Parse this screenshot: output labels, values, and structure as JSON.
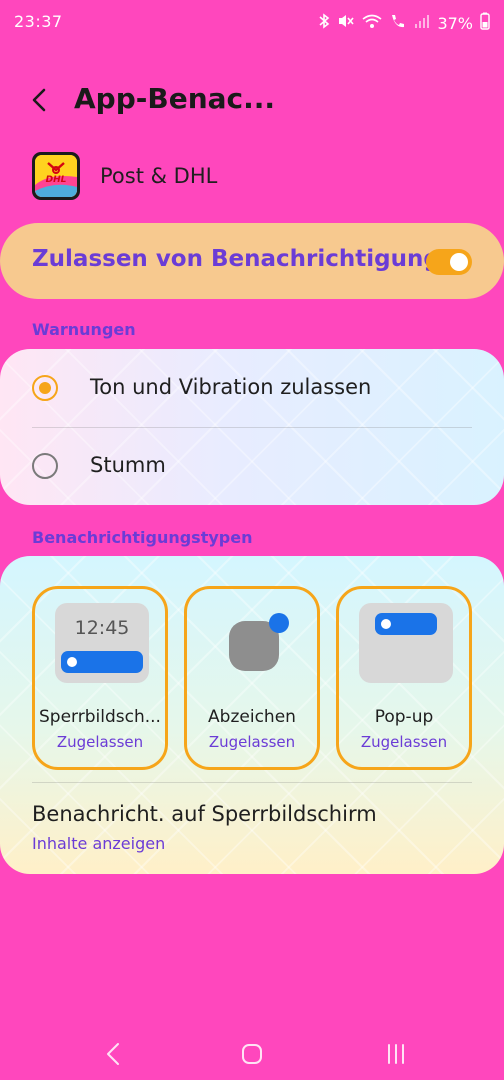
{
  "status_bar": {
    "time": "23:37",
    "battery": "37%",
    "icons": [
      "bluetooth-icon",
      "mute-icon",
      "wifi-icon",
      "wifi-call-icon",
      "signal-icon"
    ]
  },
  "header": {
    "title": "App-Benac..."
  },
  "app": {
    "name": "Post & DHL",
    "icon": "dhl-app-icon",
    "icon_text": "DHL"
  },
  "allow": {
    "label": "Zulassen von Benachrichtigungen",
    "enabled": true
  },
  "warnings": {
    "section_label": "Warnungen",
    "options": [
      {
        "label": "Ton und Vibration zulassen",
        "selected": true
      },
      {
        "label": "Stumm",
        "selected": false
      }
    ]
  },
  "types": {
    "section_label": "Benachrichtigungstypen",
    "items": [
      {
        "title": "Sperrbildsch...",
        "status": "Zugelassen",
        "preview_time": "12:45"
      },
      {
        "title": "Abzeichen",
        "status": "Zugelassen"
      },
      {
        "title": "Pop-up",
        "status": "Zugelassen"
      }
    ]
  },
  "lockscreen": {
    "title": "Benachricht. auf Sperrbildschirm",
    "value": "Inhalte anzeigen"
  },
  "colors": {
    "background": "#ff47bd",
    "accent": "#f6a51a",
    "link": "#6b3cd6",
    "allow_card": "#f7c98f"
  }
}
